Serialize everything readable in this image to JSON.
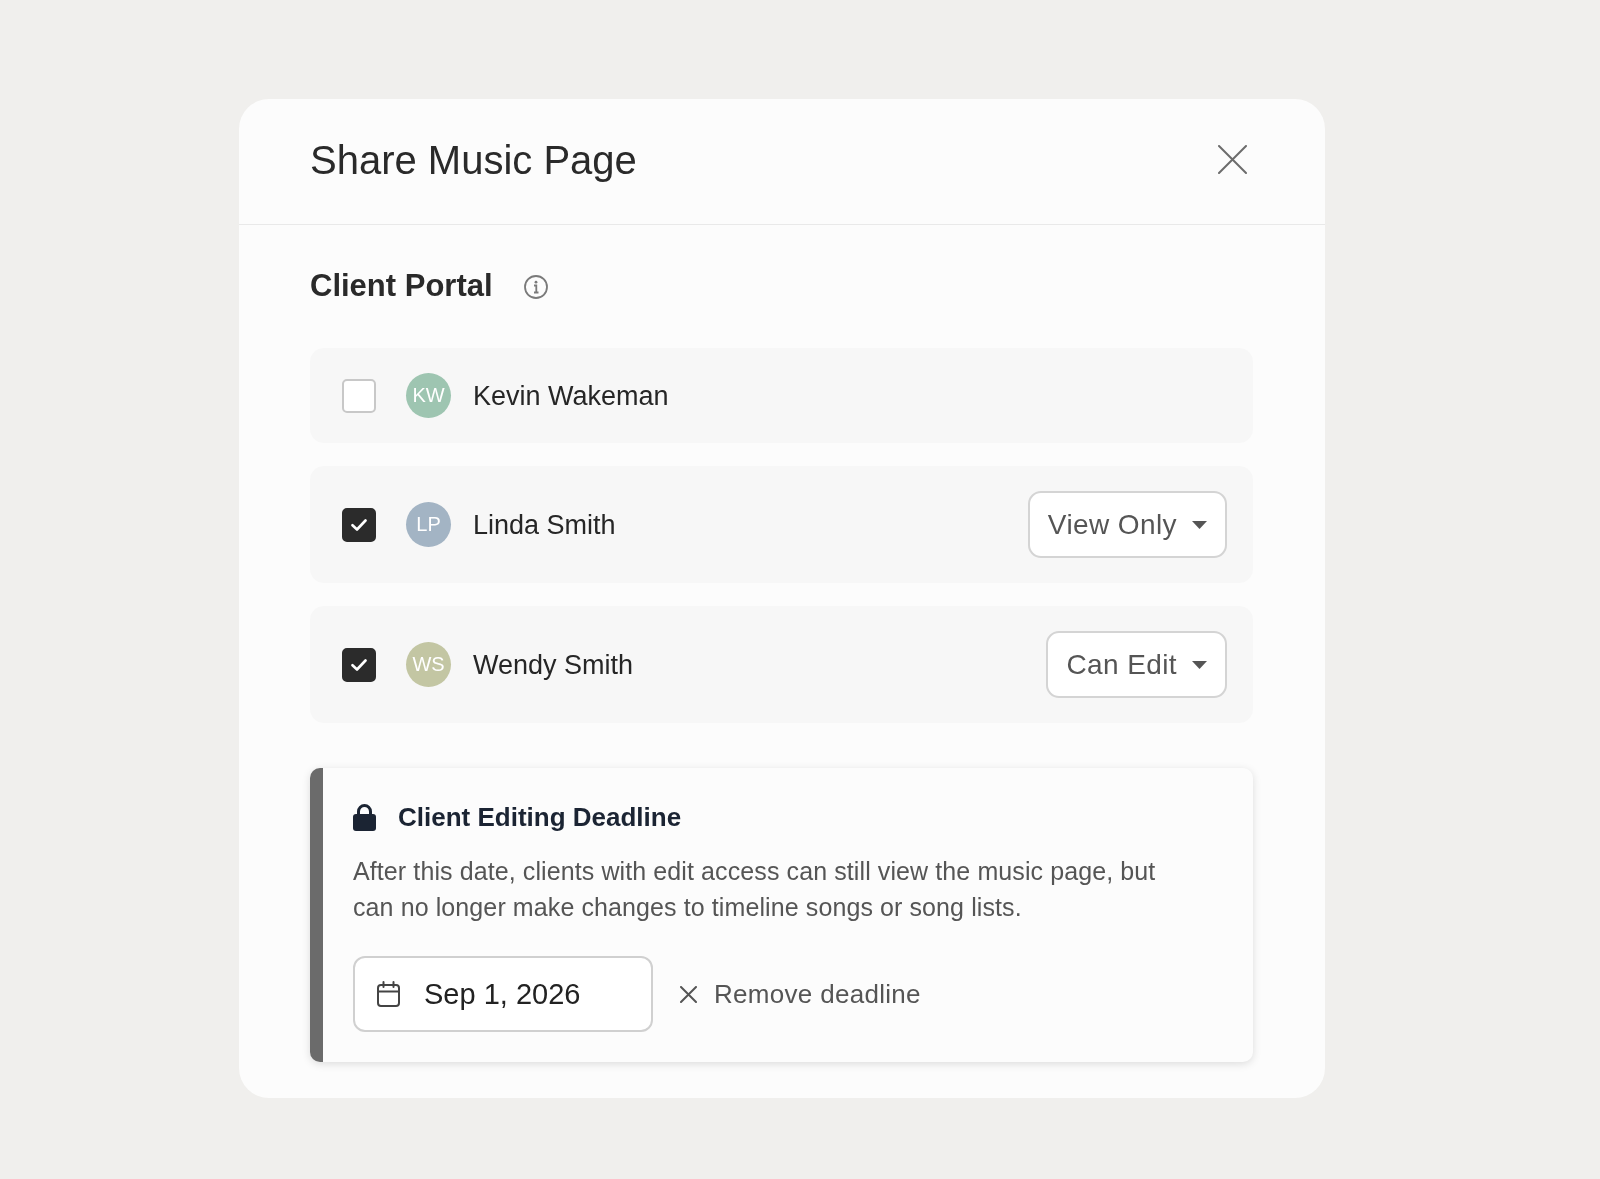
{
  "dialog": {
    "title": "Share Music Page"
  },
  "client_portal": {
    "heading": "Client Portal",
    "clients": [
      {
        "initials": "KW",
        "name": "Kevin Wakeman",
        "checked": false,
        "color": "#9ec5b1"
      },
      {
        "initials": "LP",
        "name": "Linda Smith",
        "checked": true,
        "color": "#a3b4c4",
        "permission": "View Only"
      },
      {
        "initials": "WS",
        "name": "Wendy Smith",
        "checked": true,
        "color": "#c3c6a3",
        "permission": "Can Edit"
      }
    ]
  },
  "deadline": {
    "title": "Client Editing Deadline",
    "description": "After this date, clients with edit access can still view the music page, but can no longer make changes to timeline songs or song lists.",
    "date": "Sep 1, 2026",
    "remove_label": "Remove deadline"
  }
}
